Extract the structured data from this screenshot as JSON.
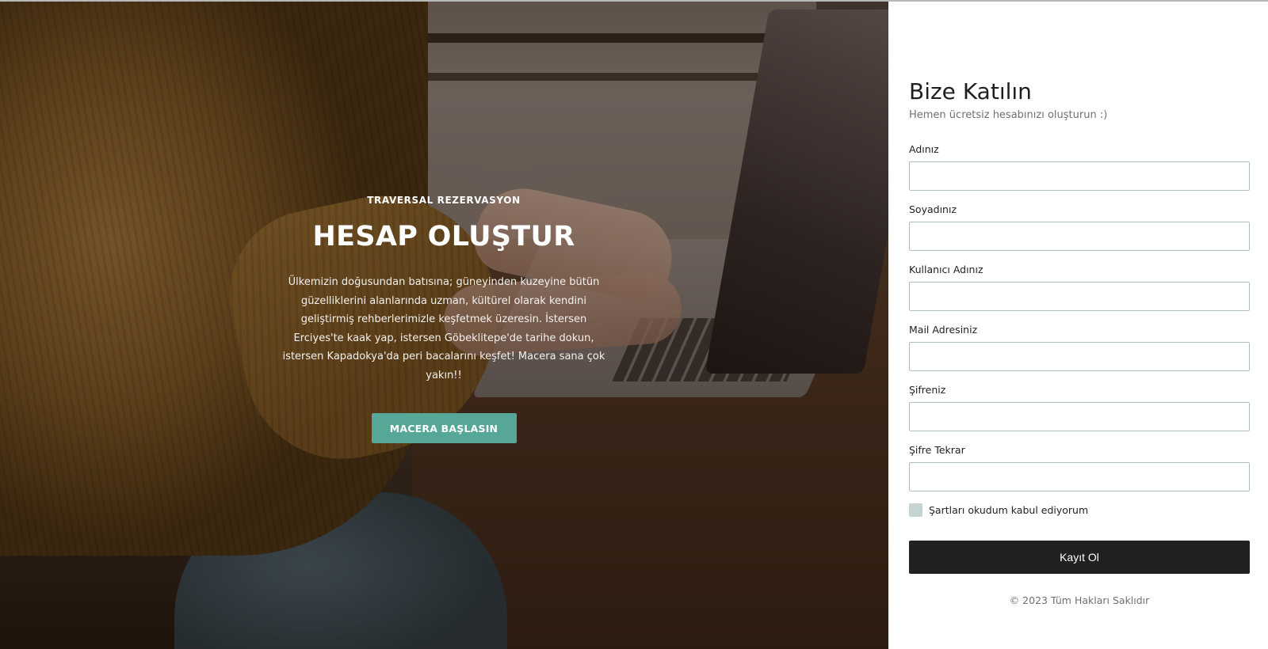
{
  "hero": {
    "eyebrow": "TRAVERSAL REZERVASYON",
    "title": "HESAP OLUŞTUR",
    "text": "Ülkemizin doğusundan batısına; güneyinden kuzeyine bütün güzelliklerini alanlarında uzman, kültürel olarak kendini geliştirmiş rehberlerimizle keşfetmek üzeresin. İstersen Erciyes'te kaak yap, istersen Göbeklitepe'de tarihe dokun, istersen Kapadokya'da peri bacalarını keşfet! Macera sana çok yakın!!",
    "button_label": "MACERA BAŞLASIN",
    "accent_color": "#56a798"
  },
  "form": {
    "title": "Bize Katılın",
    "subtitle": "Hemen ücretsiz hesabınızı oluşturun :)",
    "fields": [
      {
        "label": "Adınız",
        "value": "",
        "type": "text"
      },
      {
        "label": "Soyadınız",
        "value": "",
        "type": "text"
      },
      {
        "label": "Kullanıcı Adınız",
        "value": "",
        "type": "text"
      },
      {
        "label": "Mail Adresiniz",
        "value": "",
        "type": "email"
      },
      {
        "label": "Şifreniz",
        "value": "",
        "type": "password"
      },
      {
        "label": "Şifre Tekrar",
        "value": "",
        "type": "password"
      }
    ],
    "terms_label": "Şartları okudum kabul ediyorum",
    "terms_checked": false,
    "submit_label": "Kayıt Ol",
    "submit_color": "#212121",
    "copyright": "© 2023 Tüm Hakları Saklıdır"
  }
}
